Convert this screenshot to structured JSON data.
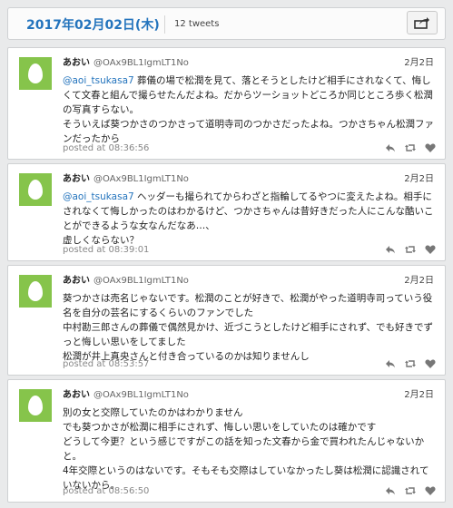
{
  "header": {
    "date": "2017年02月02日(木)",
    "tweet_count": "12 tweets"
  },
  "icons": {
    "share": "share-icon",
    "reply": "reply-icon",
    "retweet": "retweet-icon",
    "like": "heart-icon",
    "avatar": "egg-avatar"
  },
  "colors": {
    "accent": "#2474bd",
    "avatar_bg": "#86c44b"
  },
  "tweets": [
    {
      "name": "あおい",
      "handle": "@OAx9BL1IgmLT1No",
      "date": "2月2日",
      "mention": "@aoi_tsukasa7",
      "text": " 葬儀の場で松潤を見て、落とそうとしたけど相手にされなくて、悔しくて文春と組んで撮らせたんだよね。だからツーショットどころか同じところ歩く松潤の写真すらない。\nそういえば葵つかさのつかさって道明寺司のつかさだったよね。つかさちゃん松潤ファンだったから",
      "posted": "posted at 08:36:56"
    },
    {
      "name": "あおい",
      "handle": "@OAx9BL1IgmLT1No",
      "date": "2月2日",
      "mention": "@aoi_tsukasa7",
      "text": " ヘッダーも撮られてからわざと指輪してるやつに変えたよね。相手にされなくて悔しかったのはわかるけど、つかさちゃんは昔好きだった人にこんな酷いことができるような女なんだなあ…、\n虚しくならない？",
      "posted": "posted at 08:39:01"
    },
    {
      "name": "あおい",
      "handle": "@OAx9BL1IgmLT1No",
      "date": "2月2日",
      "mention": "",
      "text": "葵つかさは売名じゃないです。松潤のことが好きで、松潤がやった道明寺司っていう役名を自分の芸名にするくらいのファンでした\n中村勘三郎さんの葬儀で偶然見かけ、近づこうとしたけど相手にされず、でも好きでずっと悔しい思いをしてました\n松潤が井上真央さんと付き合っているのかは知りませんし",
      "posted": "posted at 08:53:57"
    },
    {
      "name": "あおい",
      "handle": "@OAx9BL1IgmLT1No",
      "date": "2月2日",
      "mention": "",
      "text": "別の女と交際していたのかはわかりません\nでも葵つかさが松潤に相手にされず、悔しい思いをしていたのは確かです\nどうして今更？という感じですがこの話を知った文春から金で買われたんじゃないかと。\n4年交際というのはないです。そもそも交際はしていなかったし葵は松潤に認識されていないから。",
      "posted": "posted at 08:56:50"
    }
  ]
}
